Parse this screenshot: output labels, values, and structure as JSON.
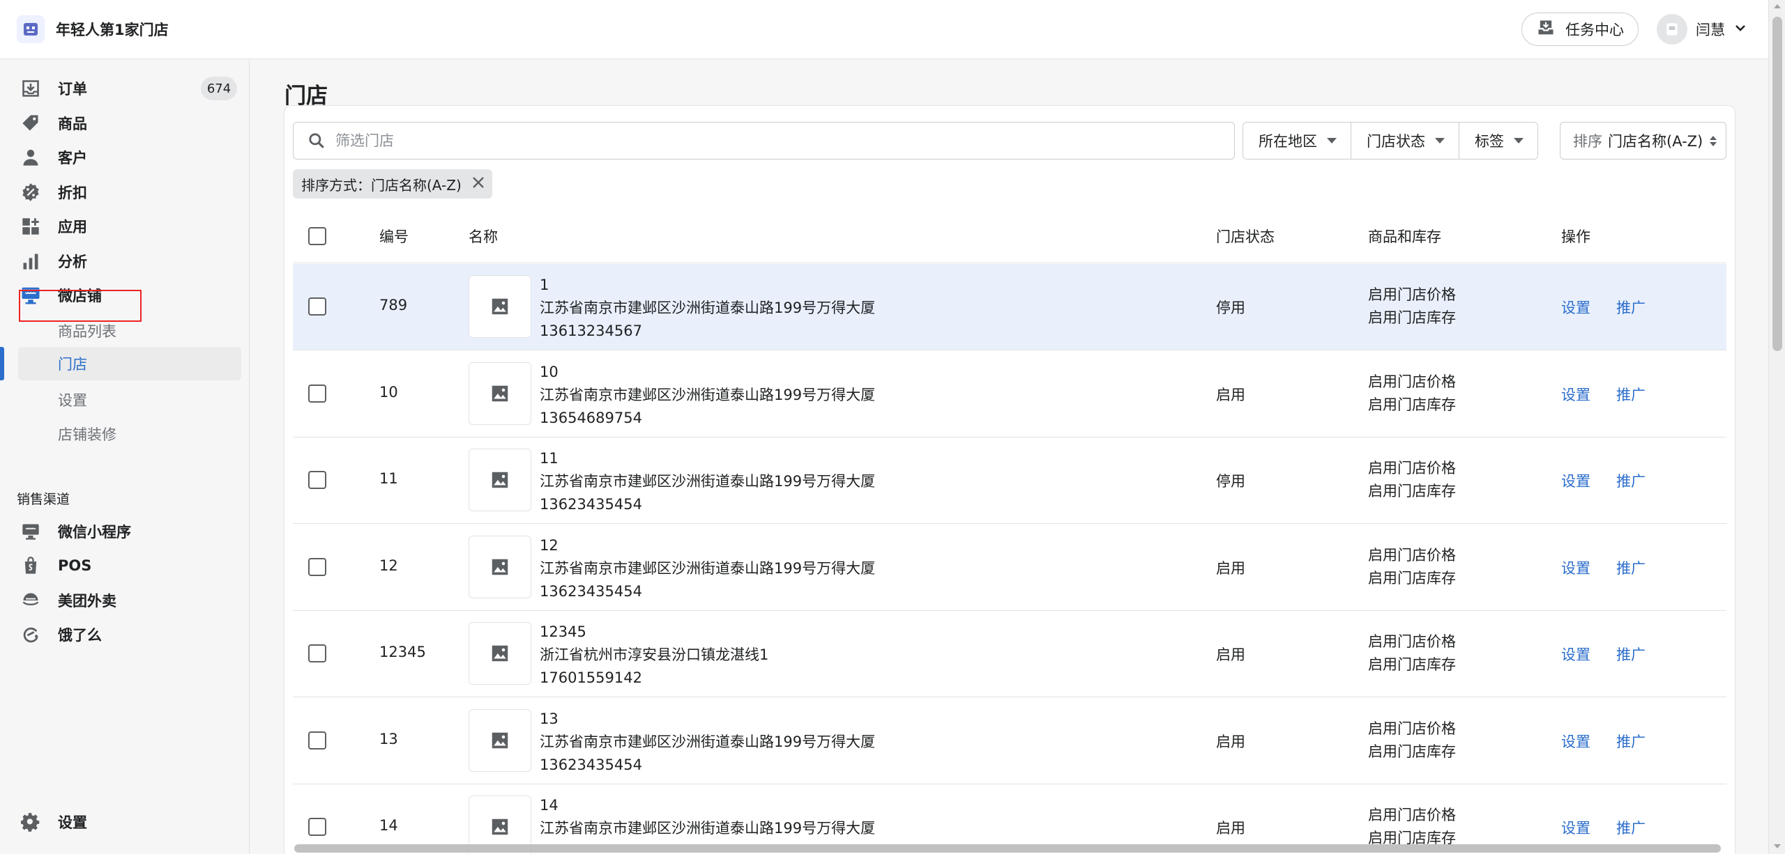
{
  "brand": {
    "name": "年轻人第1家门店"
  },
  "topbar": {
    "task_center": "任务中心",
    "user_name": "闫慧"
  },
  "sidebar": {
    "items": [
      {
        "label": "订单",
        "badge": "674",
        "icon": "order-download-icon"
      },
      {
        "label": "商品",
        "icon": "tag-icon"
      },
      {
        "label": "客户",
        "icon": "person-icon"
      },
      {
        "label": "折扣",
        "icon": "discount-icon"
      },
      {
        "label": "应用",
        "icon": "apps-icon"
      },
      {
        "label": "分析",
        "icon": "bar-chart-icon"
      },
      {
        "label": "微店铺",
        "icon": "storefront-icon"
      }
    ],
    "sub_items": [
      {
        "label": "商品列表"
      },
      {
        "label": "门店",
        "active": true
      },
      {
        "label": "设置"
      },
      {
        "label": "店铺装修"
      }
    ],
    "sales_channels_title": "销售渠道",
    "channels": [
      {
        "label": "微信小程序",
        "icon": "monitor-icon"
      },
      {
        "label": "POS",
        "icon": "shopping-bag-icon"
      },
      {
        "label": "美团外卖",
        "icon": "meituan-icon"
      },
      {
        "label": "饿了么",
        "icon": "eleme-icon"
      }
    ],
    "settings_label": "设置"
  },
  "page": {
    "title": "门店"
  },
  "toolbar": {
    "search_placeholder": "筛选门店",
    "filters": [
      {
        "label": "所在地区"
      },
      {
        "label": "门店状态"
      },
      {
        "label": "标签"
      }
    ],
    "sort_prefix": "排序",
    "sort_value": "门店名称(A-Z)",
    "active_tag": "排序方式：门店名称(A-Z)"
  },
  "table": {
    "headers": {
      "id": "编号",
      "name": "名称",
      "status": "门店状态",
      "inventory": "商品和库存",
      "actions": "操作"
    },
    "rows": [
      {
        "id": "789",
        "title": "1",
        "address": "江苏省南京市建邺区沙洲街道泰山路199号万得大厦",
        "phone": "13613234567",
        "status": "停用",
        "price": "启用门店价格",
        "stock": "启用门店库存",
        "setup": "设置",
        "promote": "推广"
      },
      {
        "id": "10",
        "title": "10",
        "address": "江苏省南京市建邺区沙洲街道泰山路199号万得大厦",
        "phone": "13654689754",
        "status": "启用",
        "price": "启用门店价格",
        "stock": "启用门店库存",
        "setup": "设置",
        "promote": "推广"
      },
      {
        "id": "11",
        "title": "11",
        "address": "江苏省南京市建邺区沙洲街道泰山路199号万得大厦",
        "phone": "13623435454",
        "status": "停用",
        "price": "启用门店价格",
        "stock": "启用门店库存",
        "setup": "设置",
        "promote": "推广"
      },
      {
        "id": "12",
        "title": "12",
        "address": "江苏省南京市建邺区沙洲街道泰山路199号万得大厦",
        "phone": "13623435454",
        "status": "启用",
        "price": "启用门店价格",
        "stock": "启用门店库存",
        "setup": "设置",
        "promote": "推广"
      },
      {
        "id": "12345",
        "title": "12345",
        "address": "浙江省杭州市淳安县汾口镇龙湛线1",
        "phone": "17601559142",
        "status": "启用",
        "price": "启用门店价格",
        "stock": "启用门店库存",
        "setup": "设置",
        "promote": "推广"
      },
      {
        "id": "13",
        "title": "13",
        "address": "江苏省南京市建邺区沙洲街道泰山路199号万得大厦",
        "phone": "13623435454",
        "status": "启用",
        "price": "启用门店价格",
        "stock": "启用门店库存",
        "setup": "设置",
        "promote": "推广"
      },
      {
        "id": "14",
        "title": "14",
        "address": "江苏省南京市建邺区沙洲街道泰山路199号万得大厦",
        "phone": "",
        "status": "启用",
        "price": "启用门店价格",
        "stock": "启用门店库存",
        "setup": "设置",
        "promote": "推广"
      }
    ]
  },
  "colors": {
    "accent": "#2c6ecb",
    "highlight_row": "#e9f0fc",
    "text": "#202223",
    "muted": "#6d7175"
  }
}
